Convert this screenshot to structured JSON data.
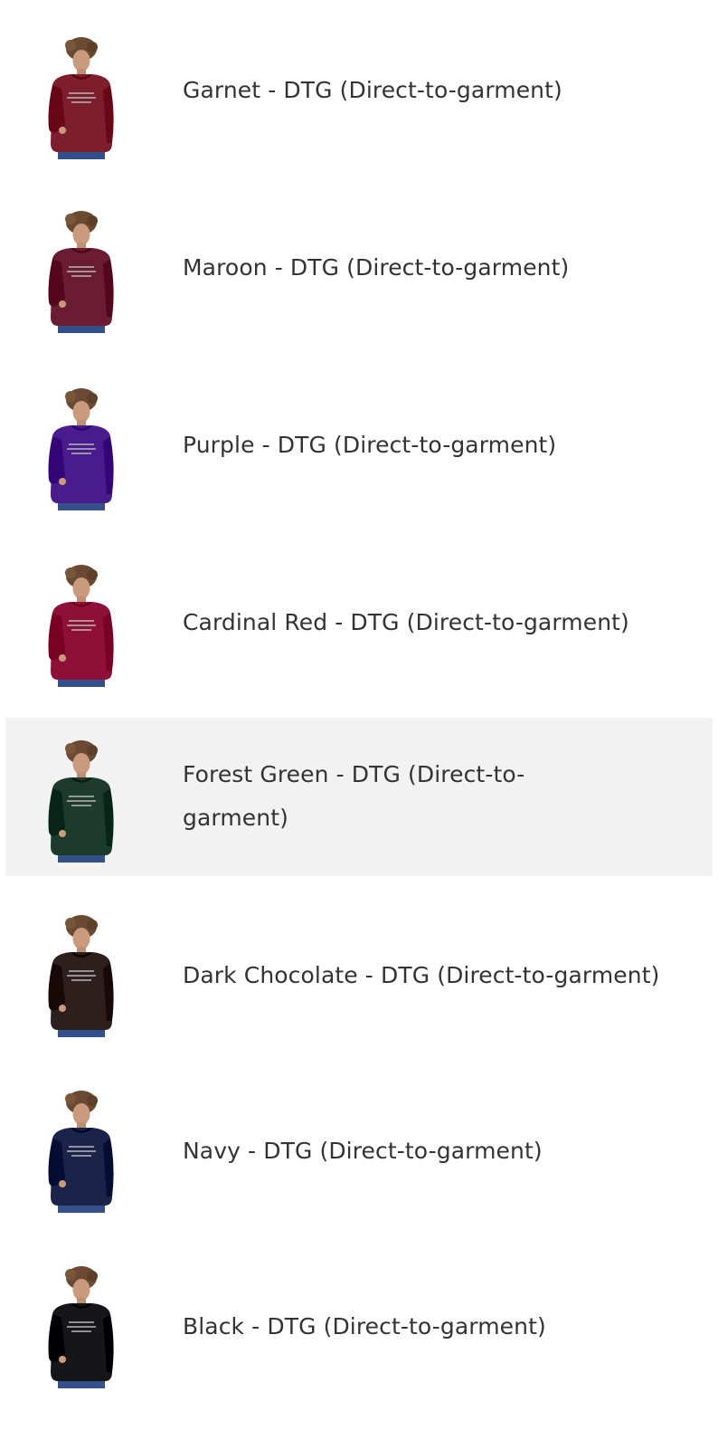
{
  "colors": {
    "selected_row_bg": "#f2f2f2",
    "text": "#333333"
  },
  "options": [
    {
      "label": "Garnet - DTG (Direct-to-garment)",
      "garment_color": "#7e1d2b",
      "selected": false
    },
    {
      "label": "Maroon - DTG (Direct-to-garment)",
      "garment_color": "#6a1c33",
      "selected": false
    },
    {
      "label": "Purple - DTG (Direct-to-garment)",
      "garment_color": "#4a1b8c",
      "selected": false
    },
    {
      "label": "Cardinal Red - DTG (Direct-to-garment)",
      "garment_color": "#8e1038",
      "selected": false
    },
    {
      "label": "Forest Green - DTG (Direct-to-garment)",
      "garment_color": "#1d3b2c",
      "selected": true
    },
    {
      "label": "Dark Chocolate - DTG (Direct-to-garment)",
      "garment_color": "#2c1f1d",
      "selected": false
    },
    {
      "label": "Navy - DTG (Direct-to-garment)",
      "garment_color": "#1a2348",
      "selected": false
    },
    {
      "label": "Black - DTG (Direct-to-garment)",
      "garment_color": "#161618",
      "selected": false
    }
  ]
}
